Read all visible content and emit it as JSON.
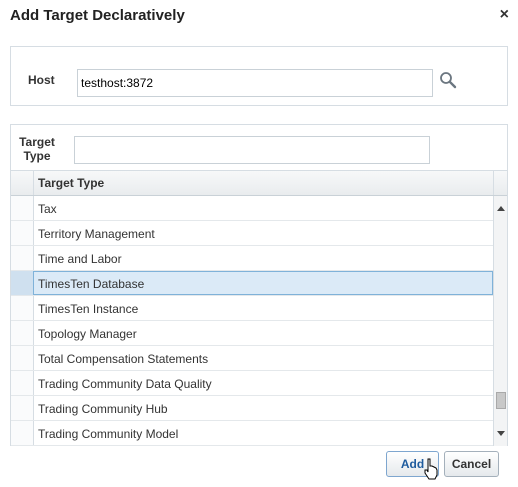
{
  "dialog": {
    "title": "Add Target Declaratively",
    "close_label": "×"
  },
  "host": {
    "label": "Host",
    "value": "testhost:3872"
  },
  "filter": {
    "label_line1": "Target",
    "label_line2": "Type",
    "value": ""
  },
  "grid": {
    "column_header": "Target Type",
    "rows": [
      "Tax",
      "Territory Management",
      "Time and Labor",
      "TimesTen Database",
      "TimesTen Instance",
      "Topology Manager",
      "Total Compensation Statements",
      "Trading Community Data Quality",
      "Trading Community Hub",
      "Trading Community Model"
    ],
    "selected_index": 3
  },
  "buttons": {
    "add_label": "Add",
    "cancel_label": "Cancel"
  },
  "icons": {
    "search": "search-icon",
    "close": "close-icon"
  },
  "colors": {
    "selected_row": "#dbeaf7",
    "add_text": "#1f5c9e"
  }
}
